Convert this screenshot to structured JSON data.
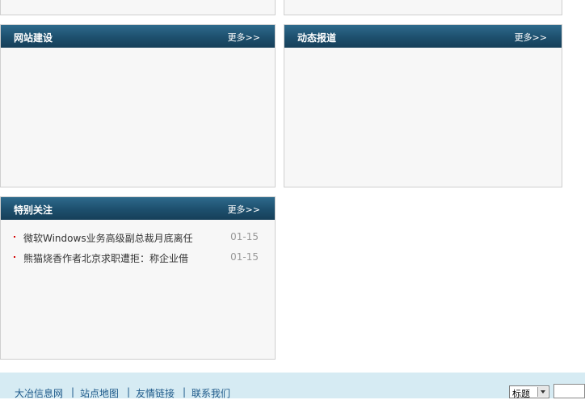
{
  "panels": {
    "website": {
      "title": "网站建设",
      "more": "更多>>"
    },
    "news": {
      "title": "动态报道",
      "more": "更多>>"
    },
    "focus": {
      "title": "特别关注",
      "more": "更多>>",
      "items": [
        {
          "title": "微软Windows业务高级副总裁月底离任",
          "date": "01-15"
        },
        {
          "title": "熊猫烧香作者北京求职遭拒：称企业借",
          "date": "01-15"
        }
      ]
    }
  },
  "footer": {
    "links": [
      "大冶信息网",
      "站点地图",
      "友情链接",
      "联系我们"
    ],
    "separator": "|",
    "search": {
      "selected_option": "标题"
    }
  },
  "colors": {
    "panel_header": "#1d4f6d",
    "panel_bg": "#f7f7f7",
    "footer_bg": "#d6ebf3",
    "bullet": "#d40000"
  }
}
